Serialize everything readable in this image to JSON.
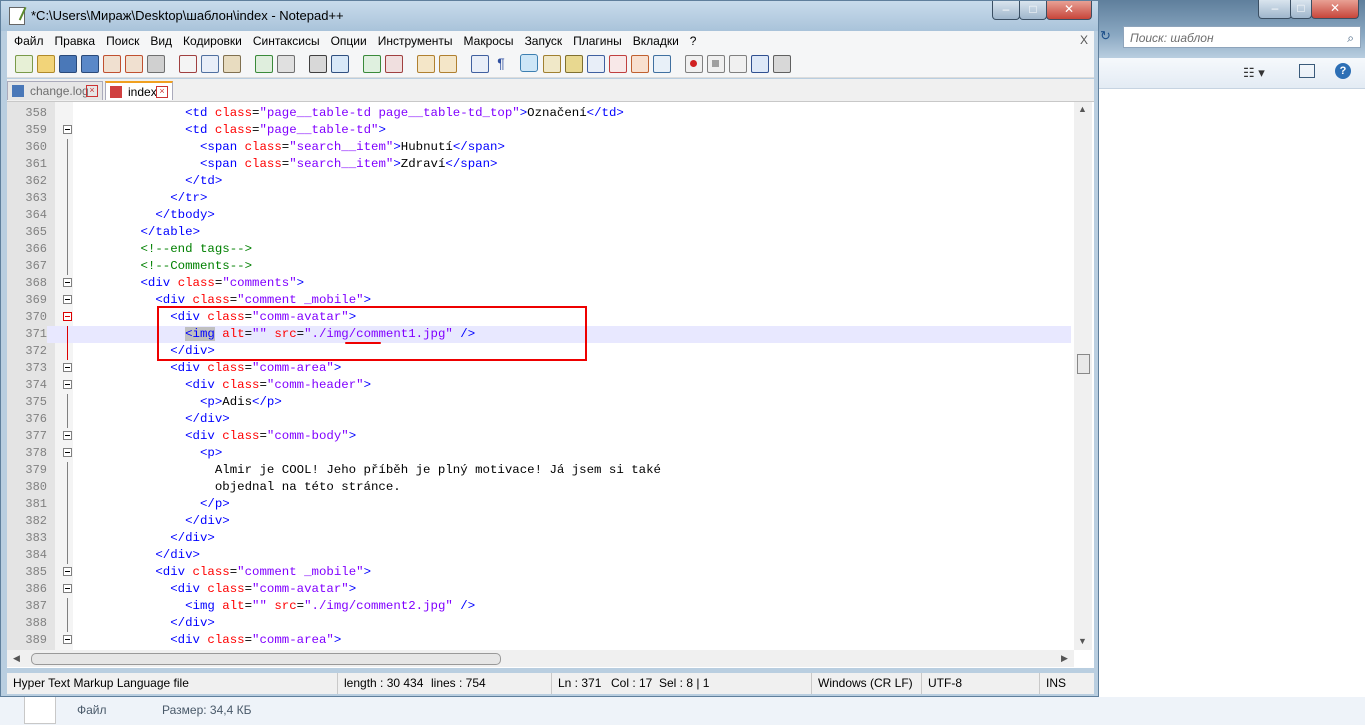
{
  "explorer": {
    "search_placeholder": "Поиск: шаблон",
    "details": {
      "type_label": "Файл",
      "size_label": "Размер: 34,4 КБ"
    }
  },
  "window": {
    "title": "*C:\\Users\\Мираж\\Desktop\\шаблон\\index - Notepad++"
  },
  "menu": {
    "items": [
      "Файл",
      "Правка",
      "Поиск",
      "Вид",
      "Кодировки",
      "Синтаксисы",
      "Опции",
      "Инструменты",
      "Макросы",
      "Запуск",
      "Плагины",
      "Вкладки",
      "?"
    ],
    "close": "X"
  },
  "tabs": [
    {
      "label": "change.log"
    },
    {
      "label": "index"
    }
  ],
  "editor": {
    "current_line": 371,
    "lines": [
      {
        "n": "358",
        "fold": "none",
        "html": "              <td class=\"page__table-td page__table-td_top\">Označení</td>"
      },
      {
        "n": "359",
        "fold": "box",
        "html": "              <td class=\"page__table-td\">"
      },
      {
        "n": "360",
        "fold": "line",
        "html": "                <span class=\"search__item\">Hubnutí</span>"
      },
      {
        "n": "361",
        "fold": "line",
        "html": "                <span class=\"search__item\">Zdraví</span>"
      },
      {
        "n": "362",
        "fold": "line",
        "html": "              </td>"
      },
      {
        "n": "363",
        "fold": "line",
        "html": "            </tr>"
      },
      {
        "n": "364",
        "fold": "line",
        "html": "          </tbody>"
      },
      {
        "n": "365",
        "fold": "line",
        "html": "        </table>"
      },
      {
        "n": "366",
        "fold": "line",
        "html": "        <!--end tags-->"
      },
      {
        "n": "367",
        "fold": "line",
        "html": "        <!--Comments-->"
      },
      {
        "n": "368",
        "fold": "box",
        "html": "        <div class=\"comments\">"
      },
      {
        "n": "369",
        "fold": "box",
        "html": "          <div class=\"comment _mobile\">"
      },
      {
        "n": "370",
        "fold": "redbox",
        "html": "            <div class=\"comm-avatar\">"
      },
      {
        "n": "371",
        "fold": "redline",
        "html": "              <img alt=\"\" src=\"./img/comment1.jpg\" />"
      },
      {
        "n": "372",
        "fold": "redline",
        "html": "            </div>"
      },
      {
        "n": "373",
        "fold": "box",
        "html": "            <div class=\"comm-area\">"
      },
      {
        "n": "374",
        "fold": "box",
        "html": "              <div class=\"comm-header\">"
      },
      {
        "n": "375",
        "fold": "line",
        "html": "                <p>Adis</p>"
      },
      {
        "n": "376",
        "fold": "line",
        "html": "              </div>"
      },
      {
        "n": "377",
        "fold": "box",
        "html": "              <div class=\"comm-body\">"
      },
      {
        "n": "378",
        "fold": "box",
        "html": "                <p>"
      },
      {
        "n": "379",
        "fold": "line",
        "html": "                  Almir je COOL! Jeho příběh je plný motivace! Já jsem si také"
      },
      {
        "n": "380",
        "fold": "line",
        "html": "                  objednal na této stránce."
      },
      {
        "n": "381",
        "fold": "line",
        "html": "                </p>"
      },
      {
        "n": "382",
        "fold": "line",
        "html": "              </div>"
      },
      {
        "n": "383",
        "fold": "line",
        "html": "            </div>"
      },
      {
        "n": "384",
        "fold": "line",
        "html": "          </div>"
      },
      {
        "n": "385",
        "fold": "box",
        "html": "          <div class=\"comment _mobile\">"
      },
      {
        "n": "386",
        "fold": "box",
        "html": "            <div class=\"comm-avatar\">"
      },
      {
        "n": "387",
        "fold": "line",
        "html": "              <img alt=\"\" src=\"./img/comment2.jpg\" />"
      },
      {
        "n": "388",
        "fold": "line",
        "html": "            </div>"
      },
      {
        "n": "389",
        "fold": "box",
        "html": "            <div class=\"comm-area\">"
      }
    ]
  },
  "status": {
    "filetype": "Hyper Text Markup Language file",
    "length": "length : 30 434",
    "lines": "lines : 754",
    "ln": "Ln : 371",
    "col": "Col : 17",
    "sel": "Sel : 8 | 1",
    "eol": "Windows (CR LF)",
    "encoding": "UTF-8",
    "mode": "INS"
  },
  "colors": {
    "tag": "#0000ff",
    "attr": "#ff0000",
    "string": "#8000ff",
    "comment": "#008000",
    "annotation": "#e00000",
    "current_line_bg": "#e8e8ff"
  }
}
